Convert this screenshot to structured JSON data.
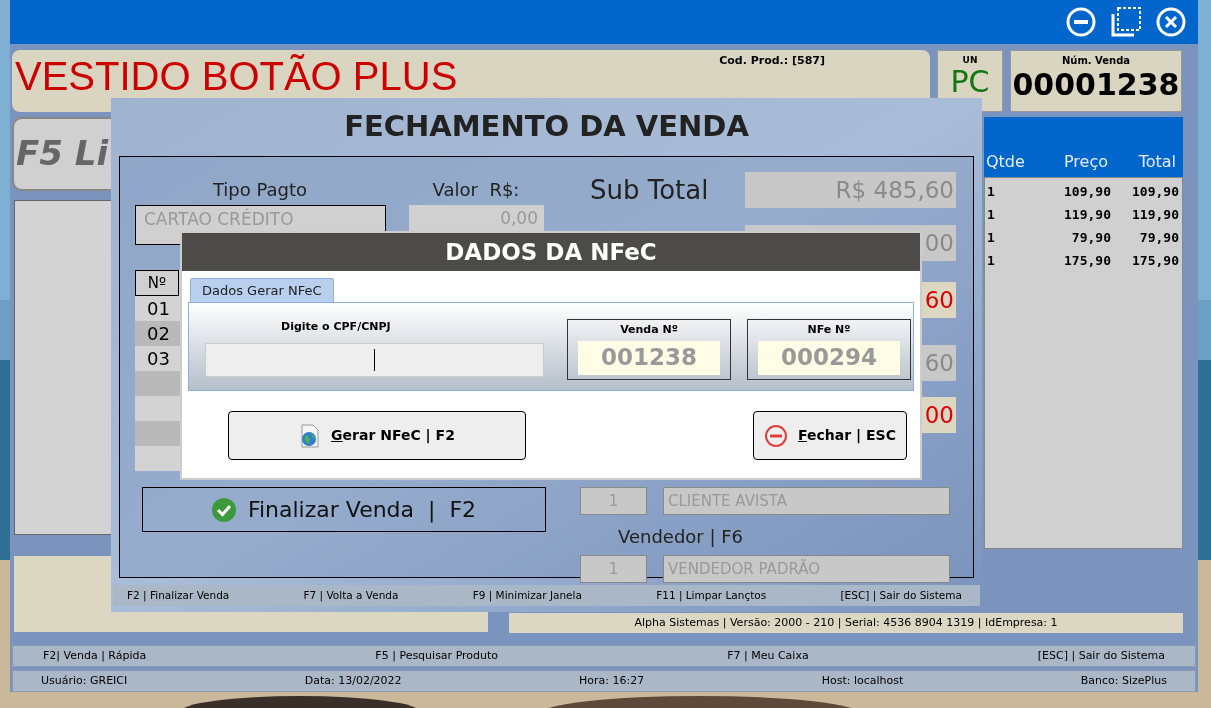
{
  "product": {
    "name": "VESTIDO BOTÃO PLUS",
    "code": "Cod. Prod.: [587]"
  },
  "unit": {
    "label": "UN",
    "value": "PC"
  },
  "sale_number": {
    "label": "Núm. Venda",
    "value": "00001238"
  },
  "list_button": "F5 Li",
  "items_table": {
    "columns": [
      "Qtde",
      "Preço",
      "Total"
    ],
    "rows": [
      [
        "1",
        "109,90",
        "109,90"
      ],
      [
        "1",
        "119,90",
        "119,90"
      ],
      [
        "1",
        "79,90",
        "79,90"
      ],
      [
        "1",
        "175,90",
        "175,90"
      ]
    ]
  },
  "version_bar": "Alpha Sistemas | Versão: 2000 - 210 | Serial:  4536 8904 1319 | IdEmpresa: 1",
  "function_bar": [
    "F2| Venda | Rápida",
    "F5 | Pesquisar Produto",
    "F7 | Meu Caixa",
    "[ESC] | Sair do Sistema"
  ],
  "status_bar": [
    "Usuário: GREICI",
    "Data: 13/02/2022",
    "Hora: 16:27",
    "Host: localhost",
    "Banco: SizePlus"
  ],
  "closing_dialog": {
    "title": "FECHAMENTO DA VENDA",
    "payment_type_label": "Tipo Pagto",
    "payment_type": "CARTAO CRÉDITO",
    "amount_label": "Valor  R$:",
    "amount": "0,00",
    "payments_table": {
      "column": "Nº",
      "rows": [
        "01",
        "02",
        "03"
      ]
    },
    "finish_button": "Finalizar Venda  |  F2",
    "subtotal_label": "Sub Total",
    "totals": [
      {
        "value": "R$ 485,60",
        "kind": "plain"
      },
      {
        "value": "00",
        "kind": "plain"
      },
      {
        "value": "60",
        "kind": "alert"
      },
      {
        "value": "60",
        "kind": "plain"
      },
      {
        "value": "00",
        "kind": "alert"
      }
    ],
    "customer": {
      "code": "1",
      "name": "CLIENTE AVISTA"
    },
    "seller_label": "Vendedor | F6",
    "seller": {
      "code": "1",
      "name": "VENDEDOR PADRÃO"
    },
    "shortcuts": [
      "F2 | Finalizar Venda",
      "F7 | Volta a Venda",
      "F9 | Minimizar Janela",
      "F11 | Limpar Lançtos",
      "[ESC] | Sair do Sistema"
    ]
  },
  "nfce_dialog": {
    "title": "DADOS DA NFeC",
    "tabs": [
      {
        "label": "Dados Gerar NFeC",
        "selected": true
      }
    ],
    "cpf_label": "Digite o CPF/CNPJ",
    "sale_no": {
      "label": "Venda Nº",
      "value": "001238"
    },
    "nfe_no": {
      "label": "NFe Nº",
      "value": "000294"
    },
    "buttons": [
      {
        "label": "Gerar NFeC | F2",
        "kind": "generate"
      },
      {
        "label": "Fechar | ESC",
        "kind": "close"
      }
    ]
  }
}
